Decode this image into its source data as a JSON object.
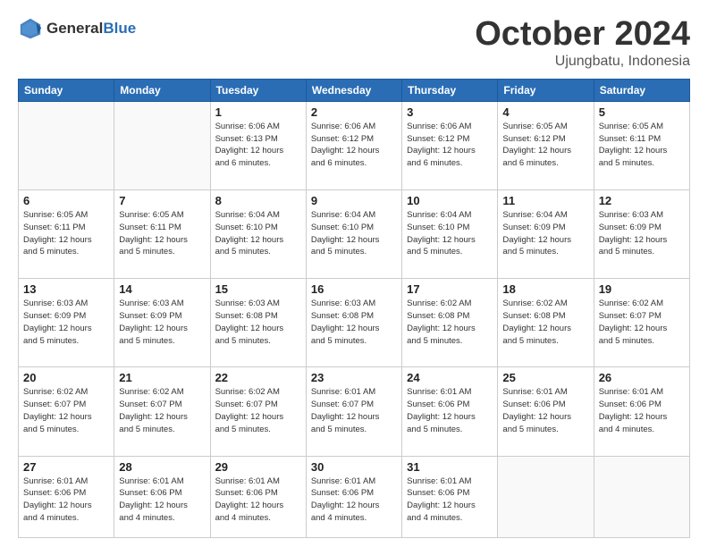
{
  "header": {
    "logo_general": "General",
    "logo_blue": "Blue",
    "month": "October 2024",
    "location": "Ujungbatu, Indonesia"
  },
  "weekdays": [
    "Sunday",
    "Monday",
    "Tuesday",
    "Wednesday",
    "Thursday",
    "Friday",
    "Saturday"
  ],
  "weeks": [
    [
      {
        "day": "",
        "info": ""
      },
      {
        "day": "",
        "info": ""
      },
      {
        "day": "1",
        "info": "Sunrise: 6:06 AM\nSunset: 6:13 PM\nDaylight: 12 hours\nand 6 minutes."
      },
      {
        "day": "2",
        "info": "Sunrise: 6:06 AM\nSunset: 6:12 PM\nDaylight: 12 hours\nand 6 minutes."
      },
      {
        "day": "3",
        "info": "Sunrise: 6:06 AM\nSunset: 6:12 PM\nDaylight: 12 hours\nand 6 minutes."
      },
      {
        "day": "4",
        "info": "Sunrise: 6:05 AM\nSunset: 6:12 PM\nDaylight: 12 hours\nand 6 minutes."
      },
      {
        "day": "5",
        "info": "Sunrise: 6:05 AM\nSunset: 6:11 PM\nDaylight: 12 hours\nand 5 minutes."
      }
    ],
    [
      {
        "day": "6",
        "info": "Sunrise: 6:05 AM\nSunset: 6:11 PM\nDaylight: 12 hours\nand 5 minutes."
      },
      {
        "day": "7",
        "info": "Sunrise: 6:05 AM\nSunset: 6:11 PM\nDaylight: 12 hours\nand 5 minutes."
      },
      {
        "day": "8",
        "info": "Sunrise: 6:04 AM\nSunset: 6:10 PM\nDaylight: 12 hours\nand 5 minutes."
      },
      {
        "day": "9",
        "info": "Sunrise: 6:04 AM\nSunset: 6:10 PM\nDaylight: 12 hours\nand 5 minutes."
      },
      {
        "day": "10",
        "info": "Sunrise: 6:04 AM\nSunset: 6:10 PM\nDaylight: 12 hours\nand 5 minutes."
      },
      {
        "day": "11",
        "info": "Sunrise: 6:04 AM\nSunset: 6:09 PM\nDaylight: 12 hours\nand 5 minutes."
      },
      {
        "day": "12",
        "info": "Sunrise: 6:03 AM\nSunset: 6:09 PM\nDaylight: 12 hours\nand 5 minutes."
      }
    ],
    [
      {
        "day": "13",
        "info": "Sunrise: 6:03 AM\nSunset: 6:09 PM\nDaylight: 12 hours\nand 5 minutes."
      },
      {
        "day": "14",
        "info": "Sunrise: 6:03 AM\nSunset: 6:09 PM\nDaylight: 12 hours\nand 5 minutes."
      },
      {
        "day": "15",
        "info": "Sunrise: 6:03 AM\nSunset: 6:08 PM\nDaylight: 12 hours\nand 5 minutes."
      },
      {
        "day": "16",
        "info": "Sunrise: 6:03 AM\nSunset: 6:08 PM\nDaylight: 12 hours\nand 5 minutes."
      },
      {
        "day": "17",
        "info": "Sunrise: 6:02 AM\nSunset: 6:08 PM\nDaylight: 12 hours\nand 5 minutes."
      },
      {
        "day": "18",
        "info": "Sunrise: 6:02 AM\nSunset: 6:08 PM\nDaylight: 12 hours\nand 5 minutes."
      },
      {
        "day": "19",
        "info": "Sunrise: 6:02 AM\nSunset: 6:07 PM\nDaylight: 12 hours\nand 5 minutes."
      }
    ],
    [
      {
        "day": "20",
        "info": "Sunrise: 6:02 AM\nSunset: 6:07 PM\nDaylight: 12 hours\nand 5 minutes."
      },
      {
        "day": "21",
        "info": "Sunrise: 6:02 AM\nSunset: 6:07 PM\nDaylight: 12 hours\nand 5 minutes."
      },
      {
        "day": "22",
        "info": "Sunrise: 6:02 AM\nSunset: 6:07 PM\nDaylight: 12 hours\nand 5 minutes."
      },
      {
        "day": "23",
        "info": "Sunrise: 6:01 AM\nSunset: 6:07 PM\nDaylight: 12 hours\nand 5 minutes."
      },
      {
        "day": "24",
        "info": "Sunrise: 6:01 AM\nSunset: 6:06 PM\nDaylight: 12 hours\nand 5 minutes."
      },
      {
        "day": "25",
        "info": "Sunrise: 6:01 AM\nSunset: 6:06 PM\nDaylight: 12 hours\nand 5 minutes."
      },
      {
        "day": "26",
        "info": "Sunrise: 6:01 AM\nSunset: 6:06 PM\nDaylight: 12 hours\nand 4 minutes."
      }
    ],
    [
      {
        "day": "27",
        "info": "Sunrise: 6:01 AM\nSunset: 6:06 PM\nDaylight: 12 hours\nand 4 minutes."
      },
      {
        "day": "28",
        "info": "Sunrise: 6:01 AM\nSunset: 6:06 PM\nDaylight: 12 hours\nand 4 minutes."
      },
      {
        "day": "29",
        "info": "Sunrise: 6:01 AM\nSunset: 6:06 PM\nDaylight: 12 hours\nand 4 minutes."
      },
      {
        "day": "30",
        "info": "Sunrise: 6:01 AM\nSunset: 6:06 PM\nDaylight: 12 hours\nand 4 minutes."
      },
      {
        "day": "31",
        "info": "Sunrise: 6:01 AM\nSunset: 6:06 PM\nDaylight: 12 hours\nand 4 minutes."
      },
      {
        "day": "",
        "info": ""
      },
      {
        "day": "",
        "info": ""
      }
    ]
  ]
}
